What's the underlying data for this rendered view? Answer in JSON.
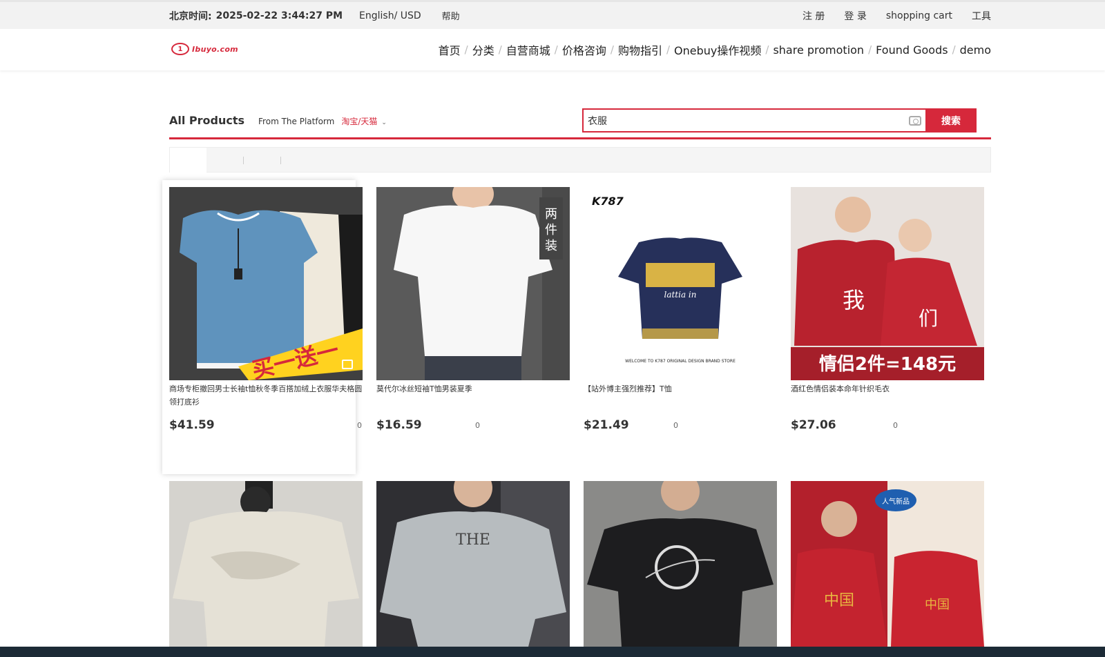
{
  "topbar": {
    "time_label": "北京时间:",
    "time_value": "2025-02-22 3:44:27 PM",
    "lang": "English/ USD",
    "help": "帮助",
    "register": "注 册",
    "login": "登 录",
    "cart": "shopping cart",
    "tools": "工具"
  },
  "header": {
    "logo_mark": "1",
    "logo_text": "Ibuyo.com",
    "nav": [
      "首页",
      "分类",
      "自营商城",
      "价格咨询",
      "购物指引",
      "Onebuy操作视频",
      "share promotion",
      "Found Goods",
      "demo"
    ]
  },
  "filter": {
    "all_products": "All Products",
    "from_label": "From The Platform",
    "platform": "淘宝/天猫"
  },
  "search": {
    "value": "衣服",
    "button": "搜索"
  },
  "products": [
    {
      "title": "商场专柜撤回男士长袖t恤秋冬季百搭加绒上衣服华夫格圆领打底衫",
      "price": "$41.59",
      "sold": "0",
      "overlay": "买一送一"
    },
    {
      "title": "莫代尔冰丝短袖T恤男装夏季",
      "price": "$16.59",
      "sold": "0",
      "overlay": "两件装"
    },
    {
      "title": "【站外博主强烈推荐】T恤",
      "price": "$21.49",
      "sold": "0",
      "overlay": "K787"
    },
    {
      "title": "酒红色情侣装本命年针织毛衣",
      "price": "$27.06",
      "sold": "0",
      "overlay": "情侣2件=148元"
    },
    {
      "title": "",
      "price": "",
      "sold": ""
    },
    {
      "title": "",
      "price": "",
      "sold": "",
      "overlay": "THE"
    },
    {
      "title": "",
      "price": "",
      "sold": ""
    },
    {
      "title": "",
      "price": "",
      "sold": "",
      "overlay": "人气新品"
    }
  ]
}
